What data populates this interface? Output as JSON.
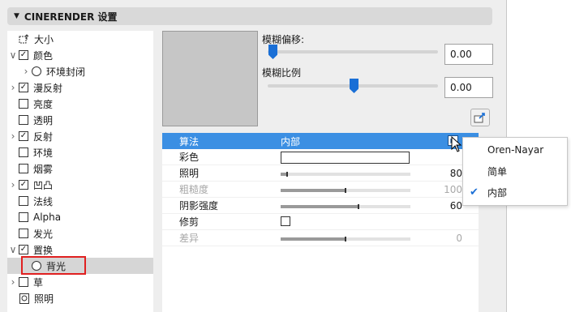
{
  "header": {
    "title": "CINERENDER 设置"
  },
  "tree": [
    {
      "label": "大小",
      "kind": "size-icon",
      "chevron": false,
      "checked": null
    },
    {
      "label": "颜色",
      "kind": "checkbox",
      "chevron": true,
      "checked": true
    },
    {
      "label": "环境封闭",
      "kind": "radio",
      "chevron": true,
      "indent": true
    },
    {
      "label": "漫反射",
      "kind": "checkbox",
      "chevron": true,
      "checked": true
    },
    {
      "label": "亮度",
      "kind": "checkbox",
      "chevron": false,
      "checked": false
    },
    {
      "label": "透明",
      "kind": "checkbox",
      "chevron": false,
      "checked": false
    },
    {
      "label": "反射",
      "kind": "checkbox",
      "chevron": true,
      "checked": true
    },
    {
      "label": "环境",
      "kind": "checkbox",
      "chevron": false,
      "checked": false
    },
    {
      "label": "烟雾",
      "kind": "checkbox",
      "chevron": false,
      "checked": false
    },
    {
      "label": "凹凸",
      "kind": "checkbox",
      "chevron": true,
      "checked": true
    },
    {
      "label": "法线",
      "kind": "checkbox",
      "chevron": false,
      "checked": false
    },
    {
      "label": "Alpha",
      "kind": "checkbox",
      "chevron": false,
      "checked": false
    },
    {
      "label": "发光",
      "kind": "checkbox",
      "chevron": false,
      "checked": false
    },
    {
      "label": "置换",
      "kind": "checkbox",
      "chevron": true,
      "checked": true
    },
    {
      "label": "背光",
      "kind": "radio",
      "chevron": false,
      "indent": true,
      "selected": true
    },
    {
      "label": "草",
      "kind": "checkbox",
      "chevron": true,
      "checked": false
    },
    {
      "label": "照明",
      "kind": "light-icon",
      "chevron": false
    }
  ],
  "blur_offset": {
    "label": "模糊偏移:",
    "value": "0.00",
    "slider_fraction": 0.0
  },
  "blur_scale": {
    "label": "模糊比例",
    "value": "0.00",
    "slider_fraction": 0.5
  },
  "table": {
    "header": {
      "label": "算法",
      "value": "内部"
    },
    "rows": [
      {
        "label": "彩色",
        "type": "color"
      },
      {
        "label": "照明",
        "type": "bar",
        "value": "80",
        "fraction": 0.05,
        "disabled": false
      },
      {
        "label": "粗糙度",
        "type": "bar",
        "value": "100",
        "fraction": 0.5,
        "disabled": true
      },
      {
        "label": "阴影强度",
        "type": "bar",
        "value": "60",
        "fraction": 0.6,
        "disabled": false
      },
      {
        "label": "修剪",
        "type": "checkbox"
      },
      {
        "label": "差异",
        "type": "bar",
        "value": "0",
        "fraction": 0.5,
        "disabled": true
      }
    ]
  },
  "menu": {
    "items": [
      {
        "label": "Oren-Nayar",
        "checked": false
      },
      {
        "label": "简单",
        "checked": false
      },
      {
        "label": "内部",
        "checked": true
      }
    ]
  },
  "colors": {
    "accent": "#3b8fe3",
    "highlight": "#e02020"
  }
}
